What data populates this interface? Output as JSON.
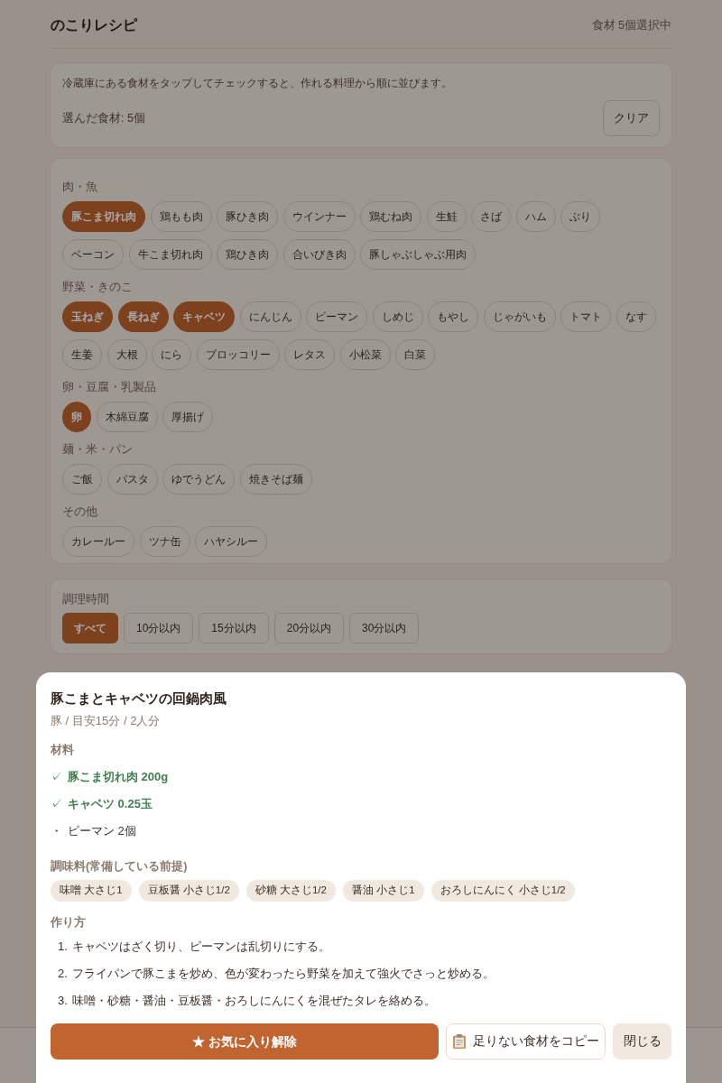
{
  "header": {
    "title": "のこりレシピ",
    "selection_count": "食材 5個選択中"
  },
  "intro": {
    "text": "冷蔵庫にある食材をタップしてチェックすると、作れる料理から順に並びます。",
    "selected_summary": "選んだ食材: 5個",
    "clear_button": "クリア"
  },
  "categories": [
    {
      "label": "肉・魚",
      "items": [
        {
          "label": "豚こま切れ肉",
          "selected": true
        },
        {
          "label": "鶏もも肉",
          "selected": false
        },
        {
          "label": "豚ひき肉",
          "selected": false
        },
        {
          "label": "ウインナー",
          "selected": false
        },
        {
          "label": "鶏むね肉",
          "selected": false
        },
        {
          "label": "生鮭",
          "selected": false
        },
        {
          "label": "さば",
          "selected": false
        },
        {
          "label": "ハム",
          "selected": false
        },
        {
          "label": "ぶり",
          "selected": false
        },
        {
          "label": "ベーコン",
          "selected": false
        },
        {
          "label": "牛こま切れ肉",
          "selected": false
        },
        {
          "label": "鶏ひき肉",
          "selected": false
        },
        {
          "label": "合いびき肉",
          "selected": false
        },
        {
          "label": "豚しゃぶしゃぶ用肉",
          "selected": false
        }
      ]
    },
    {
      "label": "野菜・きのこ",
      "items": [
        {
          "label": "玉ねぎ",
          "selected": true
        },
        {
          "label": "長ねぎ",
          "selected": true
        },
        {
          "label": "キャベツ",
          "selected": true
        },
        {
          "label": "にんじん",
          "selected": false
        },
        {
          "label": "ピーマン",
          "selected": false
        },
        {
          "label": "しめじ",
          "selected": false
        },
        {
          "label": "もやし",
          "selected": false
        },
        {
          "label": "じゃがいも",
          "selected": false
        },
        {
          "label": "トマト",
          "selected": false
        },
        {
          "label": "なす",
          "selected": false
        },
        {
          "label": "生姜",
          "selected": false
        },
        {
          "label": "大根",
          "selected": false
        },
        {
          "label": "にら",
          "selected": false
        },
        {
          "label": "ブロッコリー",
          "selected": false
        },
        {
          "label": "レタス",
          "selected": false
        },
        {
          "label": "小松菜",
          "selected": false
        },
        {
          "label": "白菜",
          "selected": false
        }
      ]
    },
    {
      "label": "卵・豆腐・乳製品",
      "items": [
        {
          "label": "卵",
          "selected": true
        },
        {
          "label": "木綿豆腐",
          "selected": false
        },
        {
          "label": "厚揚げ",
          "selected": false
        }
      ]
    },
    {
      "label": "麺・米・パン",
      "items": [
        {
          "label": "ご飯",
          "selected": false
        },
        {
          "label": "パスタ",
          "selected": false
        },
        {
          "label": "ゆでうどん",
          "selected": false
        },
        {
          "label": "焼きそば麺",
          "selected": false
        }
      ]
    },
    {
      "label": "その他",
      "items": [
        {
          "label": "カレールー",
          "selected": false
        },
        {
          "label": "ツナ缶",
          "selected": false
        },
        {
          "label": "ハヤシルー",
          "selected": false
        }
      ]
    }
  ],
  "time_filter": {
    "label": "調理時間",
    "options": [
      {
        "label": "すべて",
        "selected": true
      },
      {
        "label": "10分以内",
        "selected": false
      },
      {
        "label": "15分以内",
        "selected": false
      },
      {
        "label": "20分以内",
        "selected": false
      },
      {
        "label": "30分以内",
        "selected": false
      }
    ]
  },
  "recipe_modal": {
    "title": "豚こまとキャベツの回鍋肉風",
    "meta": "豚 / 目安15分 / 2人分",
    "ingredients_label": "材料",
    "ingredients": [
      {
        "mark": "✓",
        "text": "豚こま切れ肉 200g",
        "have": true
      },
      {
        "mark": "✓",
        "text": "キャベツ 0.25玉",
        "have": true
      },
      {
        "mark": "・",
        "text": "ピーマン 2個",
        "have": false
      }
    ],
    "seasonings_label": "調味料(常備している前提)",
    "seasonings": [
      "味噌 大さじ1",
      "豆板醤 小さじ1/2",
      "砂糖 大さじ1/2",
      "醤油 小さじ1",
      "おろしにんにく 小さじ1/2"
    ],
    "steps_label": "作り方",
    "steps": [
      {
        "number": "1.",
        "text": "キャベツはざく切り、ピーマンは乱切りにする。"
      },
      {
        "number": "2.",
        "text": "フライパンで豚こまを炒め、色が変わったら野菜を加えて強火でさっと炒める。"
      },
      {
        "number": "3.",
        "text": "味噌・砂糖・醤油・豆板醤・おろしにんにくを混ぜたタレを絡める。"
      }
    ],
    "buttons": [
      {
        "kind": "primary",
        "label": "★ お気に入り解除"
      },
      {
        "kind": "copy",
        "label": "足りない食材をコピー"
      },
      {
        "kind": "secondary",
        "label": "閉じる"
      }
    ]
  }
}
